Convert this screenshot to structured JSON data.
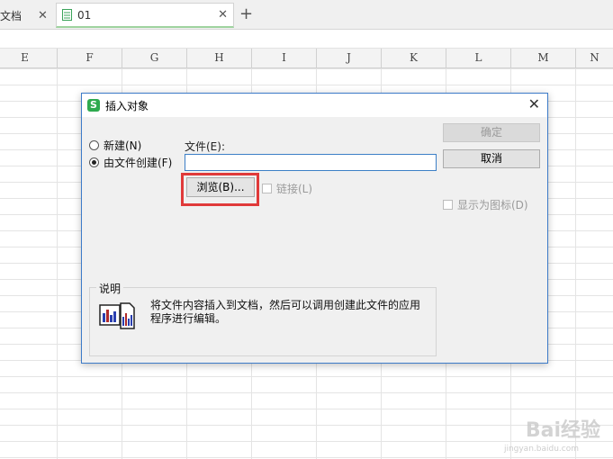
{
  "tabs": [
    {
      "label": "文档",
      "close": "✕"
    },
    {
      "label": "01",
      "close": "✕"
    }
  ],
  "new_tab": "+",
  "columns": [
    "E",
    "F",
    "G",
    "H",
    "I",
    "J",
    "K",
    "L",
    "M",
    "N"
  ],
  "dialog": {
    "title": "插入对象",
    "close": "✕",
    "radio_new": "新建(N)",
    "radio_from_file": "由文件创建(F)",
    "file_label": "文件(E):",
    "file_value": "",
    "browse_label": "浏览(B)...",
    "link_label": "链接(L)",
    "ok_label": "确定",
    "cancel_label": "取消",
    "display_as_icon_label": "显示为图标(D)",
    "desc_title": "说明",
    "desc_text": "将文件内容插入到文档，然后可以调用创建此文件的应用程序进行编辑。"
  },
  "watermark": {
    "brand": "Bai经验",
    "url": "jingyan.baidu.com"
  },
  "colors": {
    "accent_border": "#3d7bc8",
    "highlight": "#e03a3a",
    "wps_green": "#2eaa4f"
  }
}
